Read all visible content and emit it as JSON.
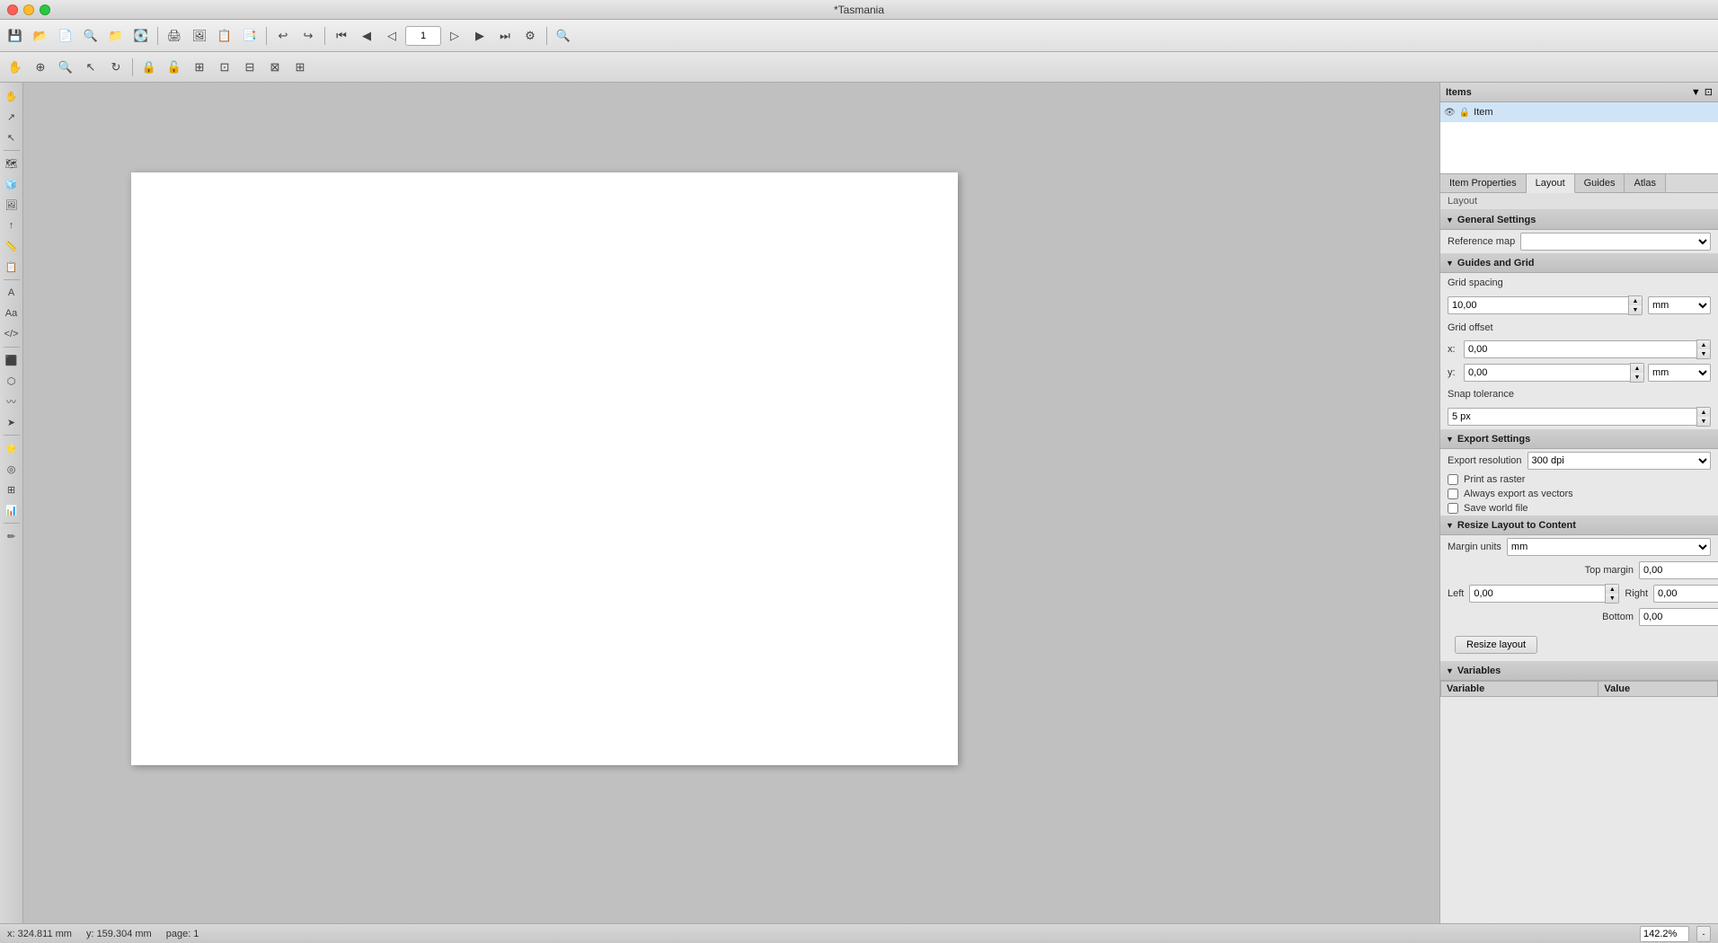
{
  "window": {
    "title": "*Tasmania"
  },
  "titlebar": {
    "title": "*Tasmania"
  },
  "toolbar1": {
    "page_value": "1",
    "page_placeholder": "1"
  },
  "items_panel": {
    "title": "Items",
    "item_name": "Item"
  },
  "tabs": {
    "items": [
      {
        "label": "Item Properties",
        "active": false
      },
      {
        "label": "Layout",
        "active": true
      },
      {
        "label": "Guides",
        "active": false
      },
      {
        "label": "Atlas",
        "active": false
      }
    ]
  },
  "layout_label": "Layout",
  "sections": {
    "general_settings": {
      "title": "General Settings",
      "reference_map_label": "Reference map",
      "reference_map_value": ""
    },
    "guides_and_grid": {
      "title": "Guides and Grid",
      "grid_spacing_label": "Grid spacing",
      "grid_spacing_value": "10,00",
      "grid_spacing_unit": "mm",
      "grid_offset_label": "Grid offset",
      "offset_x_label": "x:",
      "offset_x_value": "0,00",
      "offset_y_label": "y:",
      "offset_y_value": "0,00",
      "offset_unit": "mm",
      "snap_tolerance_label": "Snap tolerance",
      "snap_tolerance_value": "5 px"
    },
    "export_settings": {
      "title": "Export Settings",
      "export_resolution_label": "Export resolution",
      "export_resolution_value": "300 dpi",
      "print_as_raster_label": "Print as raster",
      "always_export_vectors_label": "Always export as vectors",
      "save_world_file_label": "Save world file",
      "print_as_raster_checked": false,
      "always_export_vectors_checked": false,
      "save_world_file_checked": false
    },
    "resize_layout": {
      "title": "Resize Layout to Content",
      "margin_units_label": "Margin units",
      "margin_units_value": "mm",
      "top_margin_label": "Top margin",
      "top_margin_value": "0,00",
      "left_label": "Left",
      "left_value": "0,00",
      "right_label": "Right",
      "right_value": "0,00",
      "bottom_label": "Bottom",
      "bottom_value": "0,00",
      "resize_button_label": "Resize layout"
    },
    "variables": {
      "title": "Variables",
      "col_variable": "Variable",
      "col_value": "Value"
    }
  },
  "statusbar": {
    "x_label": "x: 324.811 mm",
    "y_label": "y: 159.304 mm",
    "page_label": "page: 1",
    "zoom_value": "142.2%"
  }
}
